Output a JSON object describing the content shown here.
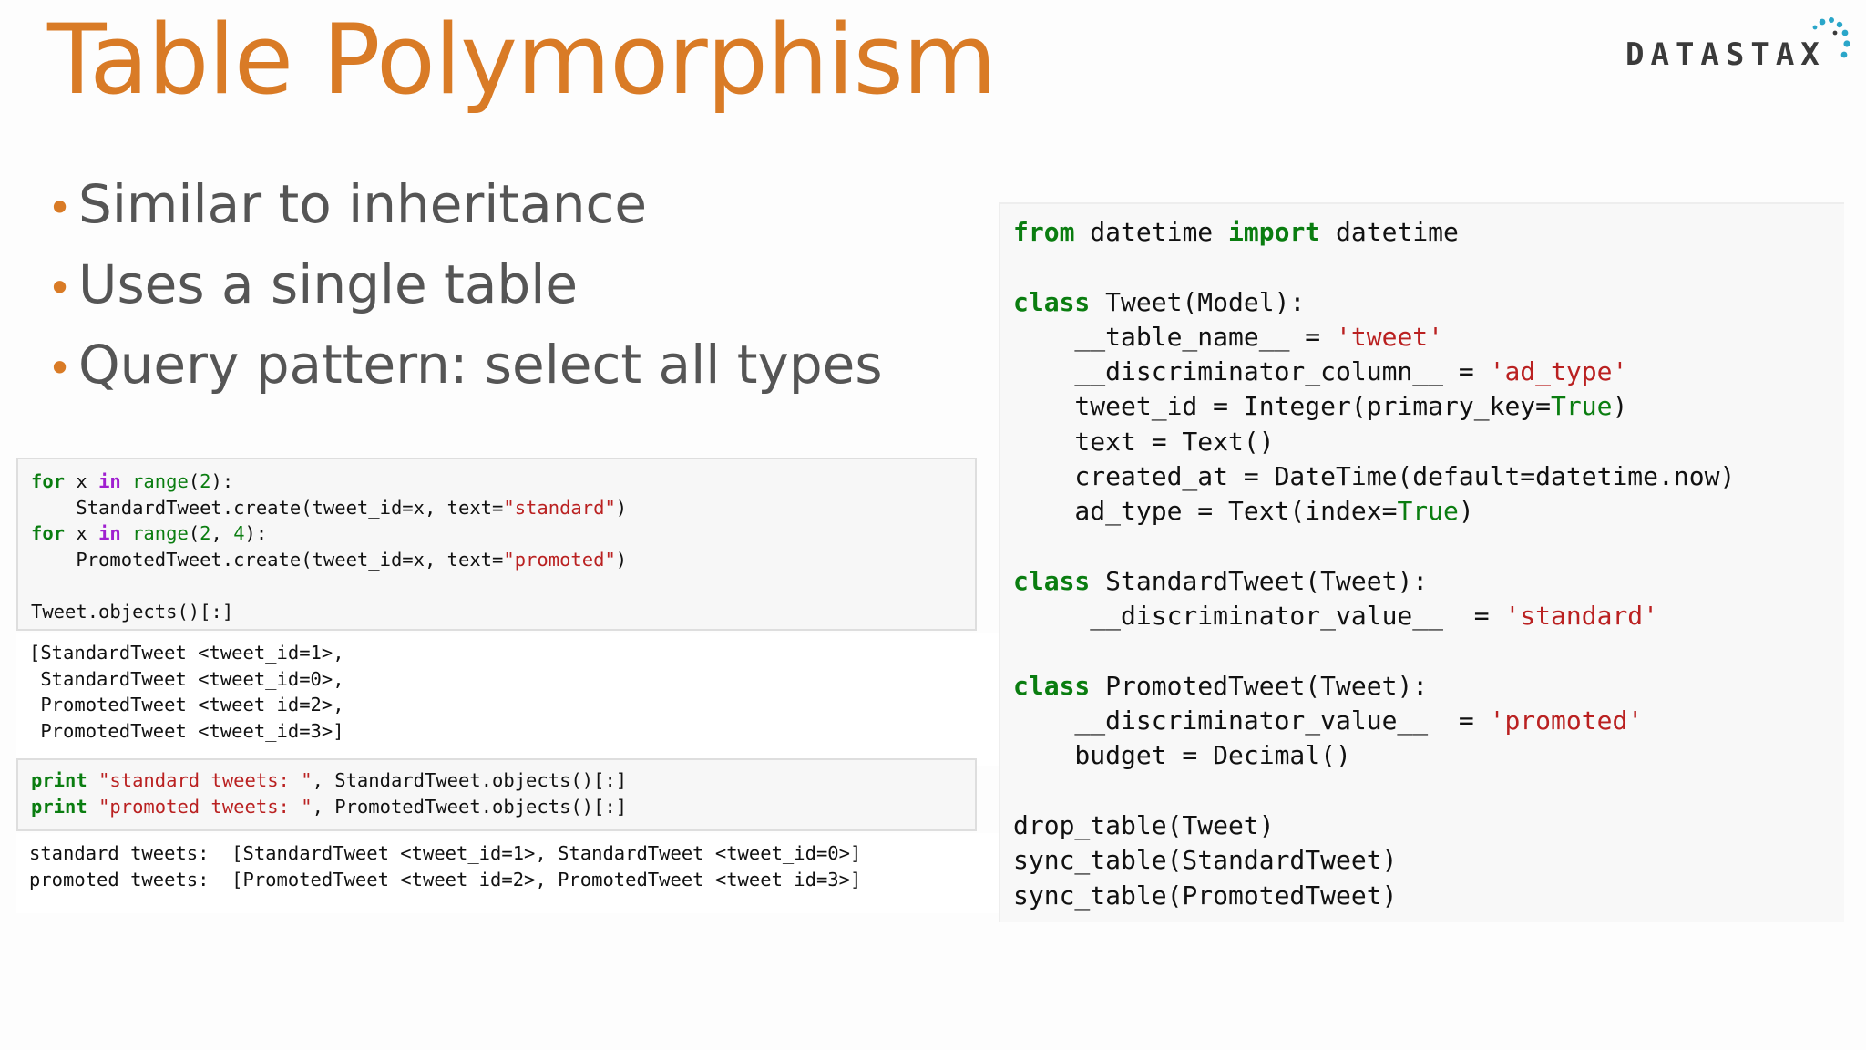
{
  "slide": {
    "title": "Table Polymorphism",
    "logo": {
      "text": "DATASTAX",
      "icon": "datastax-dots-icon",
      "accent_color": "#2aa6c9"
    },
    "bullets": [
      "Similar to inheritance",
      "Uses a single table",
      "Query pattern: select all types"
    ],
    "colors": {
      "title": "#d97b26",
      "bullet_dot": "#d97b26",
      "keyword": "#0a7d10",
      "operator_keyword": "#a020d0",
      "string": "#ba2121"
    }
  },
  "notebook": {
    "cell1": {
      "l1": {
        "a": "for",
        "b": " x ",
        "c": "in",
        "d": " ",
        "e": "range",
        "f": "(",
        "g": "2",
        "h": "):"
      },
      "l2": {
        "a": "    StandardTweet.create(tweet_id=x, text=",
        "b": "\"standard\"",
        "c": ")"
      },
      "l3": {
        "a": "for",
        "b": " x ",
        "c": "in",
        "d": " ",
        "e": "range",
        "f": "(",
        "g": "2",
        "h": ", ",
        "i": "4",
        "j": "):"
      },
      "l4": {
        "a": "    PromotedTweet.create(tweet_id=x, text=",
        "b": "\"promoted\"",
        "c": ")"
      },
      "l5": "",
      "l6": "Tweet.objects()[:]"
    },
    "output1": [
      "[StandardTweet <tweet_id=1>,",
      " StandardTweet <tweet_id=0>,",
      " PromotedTweet <tweet_id=2>,",
      " PromotedTweet <tweet_id=3>]"
    ],
    "cell2": {
      "l1": {
        "a": "print",
        "b": " ",
        "c": "\"standard tweets: \"",
        "d": ", StandardTweet.objects()[:]"
      },
      "l2": {
        "a": "print",
        "b": " ",
        "c": "\"promoted tweets: \"",
        "d": ", PromotedTweet.objects()[:]"
      }
    },
    "output2": [
      "standard tweets:  [StandardTweet <tweet_id=1>, StandardTweet <tweet_id=0>]",
      "promoted tweets:  [PromotedTweet <tweet_id=2>, PromotedTweet <tweet_id=3>]"
    ]
  },
  "code": {
    "l1": {
      "a": "from",
      "b": " datetime ",
      "c": "import",
      "d": " datetime"
    },
    "l3": {
      "a": "class",
      "b": " Tweet(Model):"
    },
    "l4": {
      "a": "    __table_name__ = ",
      "b": "'tweet'"
    },
    "l5": {
      "a": "    __discriminator_column__ = ",
      "b": "'ad_type'"
    },
    "l6": {
      "a": "    tweet_id = Integer(primary_key=",
      "b": "True",
      "c": ")"
    },
    "l7": "    text = Text()",
    "l8": "    created_at = DateTime(default=datetime.now)",
    "l9": {
      "a": "    ad_type = Text(index=",
      "b": "True",
      "c": ")"
    },
    "l11": {
      "a": "class",
      "b": " StandardTweet(Tweet):"
    },
    "l12": {
      "a": "     __discriminator_value__  = ",
      "b": "'standard'"
    },
    "l14": {
      "a": "class",
      "b": " PromotedTweet(Tweet):"
    },
    "l15": {
      "a": "    __discriminator_value__  = ",
      "b": "'promoted'"
    },
    "l16": "    budget = Decimal()",
    "l18": "drop_table(Tweet)",
    "l19": "sync_table(StandardTweet)",
    "l20": "sync_table(PromotedTweet)"
  }
}
